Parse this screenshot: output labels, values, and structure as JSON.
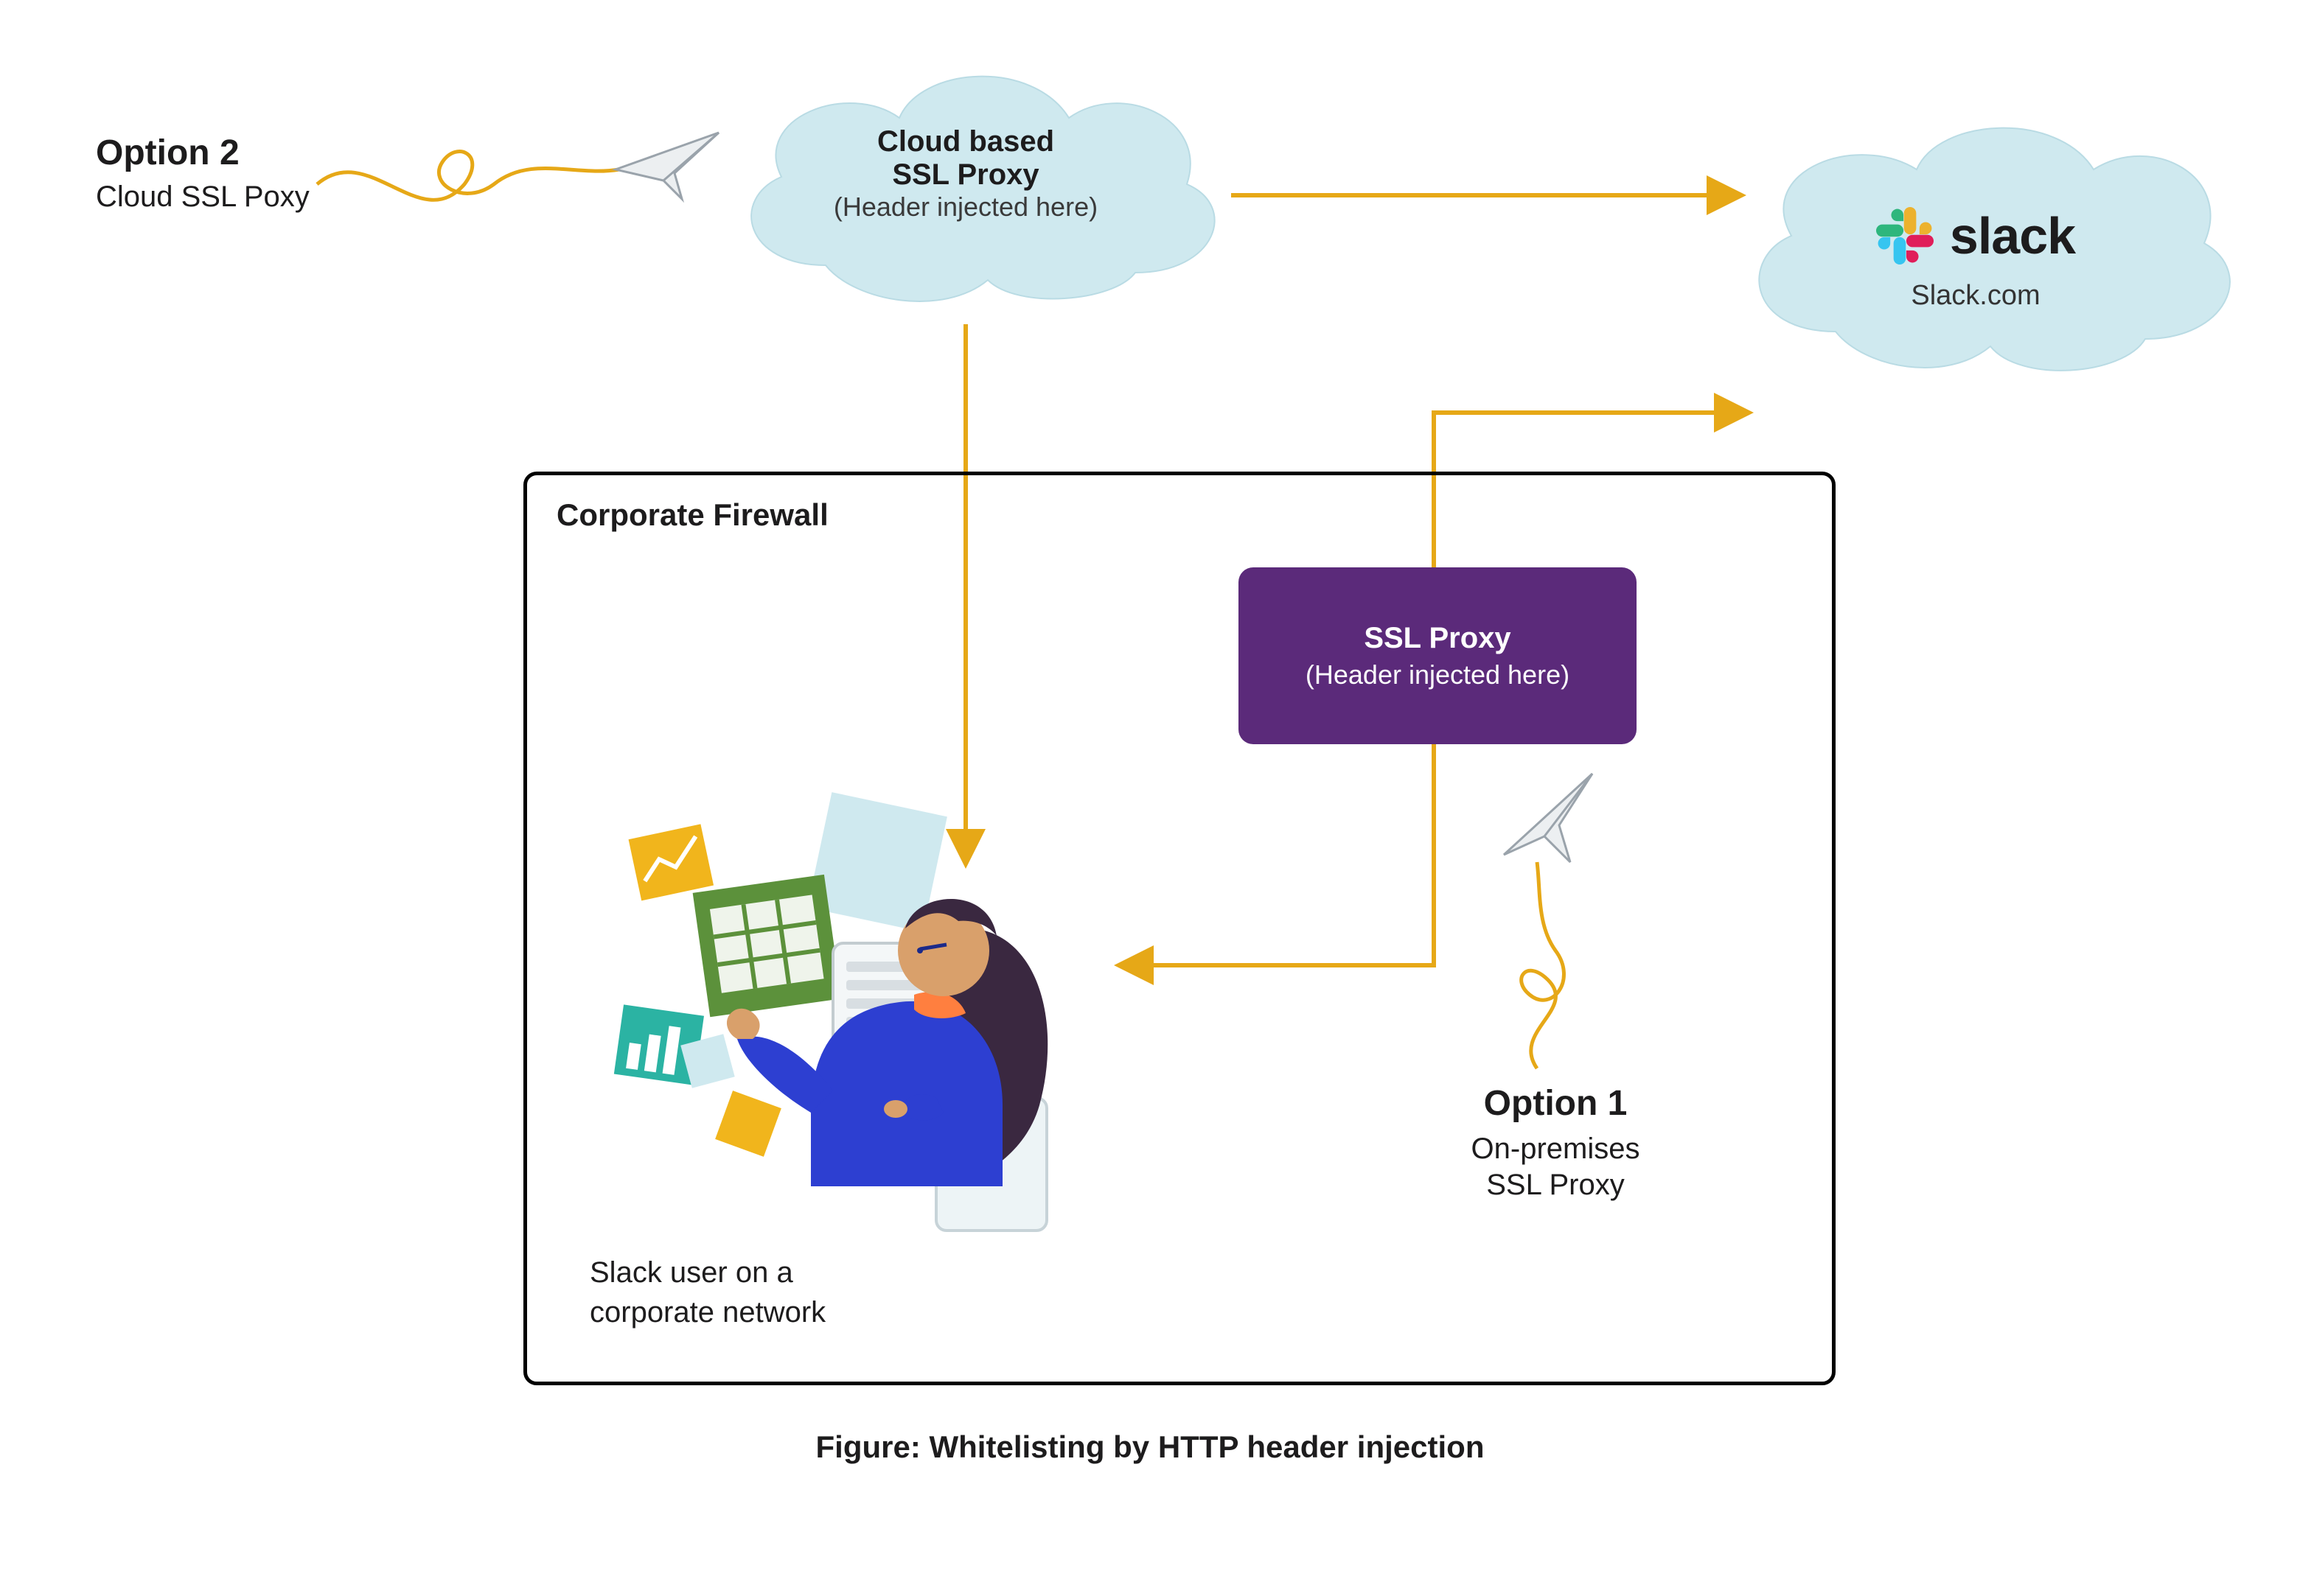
{
  "option2": {
    "title": "Option 2",
    "subtitle": "Cloud SSL Poxy"
  },
  "option1": {
    "title": "Option 1",
    "subtitle_l1": "On-premises",
    "subtitle_l2": "SSL Proxy"
  },
  "cloud_proxy": {
    "l1": "Cloud based",
    "l2": "SSL Proxy",
    "l3": "(Header injected here)"
  },
  "slack": {
    "brand": "slack",
    "domain": "Slack.com"
  },
  "firewall": {
    "label": "Corporate Firewall"
  },
  "ssl_box": {
    "title": "SSL Proxy",
    "sub": "(Header injected here)"
  },
  "user": {
    "l1": "Slack user on a",
    "l2": "corporate network"
  },
  "caption": "Figure: Whitelisting by HTTP header injection",
  "colors": {
    "cloud_fill": "#cfe9ef",
    "cloud_stroke": "#b9dbe4",
    "arrow": "#e6a817",
    "purple": "#5b2a7a",
    "green": "#5c913b",
    "teal": "#2bb3a3",
    "yellow": "#f1b51c",
    "blue": "#2d3fd1"
  }
}
